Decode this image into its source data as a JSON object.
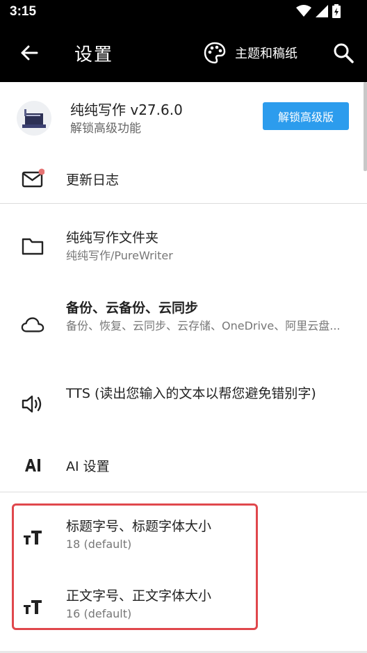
{
  "status": {
    "time": "3:15"
  },
  "appbar": {
    "title": "设置",
    "theme_label": "主题和稿纸"
  },
  "header": {
    "app_name": "纯纯写作 v27.6.0",
    "subtitle": "解锁高级功能",
    "unlock_label": "解锁高级版"
  },
  "items": [
    {
      "title": "更新日志",
      "icon": "mail-icon"
    },
    {
      "title": "纯纯写作文件夹",
      "subtitle": "纯纯写作/PureWriter",
      "icon": "folder-icon"
    },
    {
      "title": "备份、云备份、云同步",
      "subtitle": "备份、恢复、云同步、云存储、OneDrive、阿里云盘...",
      "icon": "cloud-icon"
    },
    {
      "title": "TTS (读出您输入的文本以帮您避免错别字)",
      "icon": "speaker-icon"
    },
    {
      "title": "AI 设置",
      "icon": "ai-icon"
    },
    {
      "title": "标题字号、标题字体大小",
      "subtitle": "18 (default)",
      "icon": "text-size-icon"
    },
    {
      "title": "正文字号、正文字体大小",
      "subtitle": "16 (default)",
      "icon": "text-size-icon"
    }
  ],
  "colors": {
    "accent": "#2c9ced",
    "highlight": "#e0474c",
    "badge": "#e57373"
  }
}
